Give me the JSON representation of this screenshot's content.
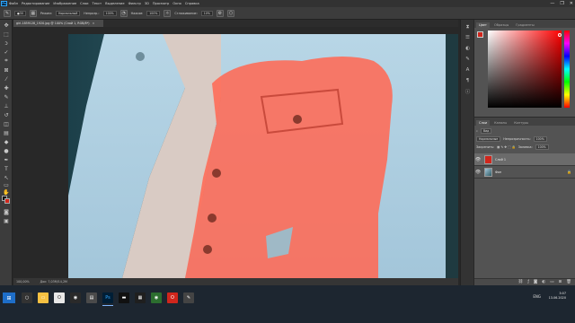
{
  "menubar": {
    "logo": "Ps",
    "items": [
      "Файл",
      "Редактирование",
      "Изображение",
      "Слои",
      "Текст",
      "Выделение",
      "Фильтр",
      "3D",
      "Просмотр",
      "Окно",
      "Справка"
    ],
    "window_controls": [
      "—",
      "❐",
      "✕"
    ]
  },
  "optionsbar": {
    "brush_size": "30",
    "mode_label": "Режим:",
    "mode_value": "Нормальный",
    "opacity_label": "Непрозр.:",
    "opacity_value": "100%",
    "flow_label": "Нажим:",
    "flow_value": "100%",
    "smoothing_label": "Сглаживание:",
    "smoothing_value": "10%"
  },
  "document": {
    "tab_title": "girl-1859128_1920.jpg @ 100% (Слой 1, RGB/8*)",
    "close_glyph": "×",
    "zoom": "100,00%",
    "doc_info": "Док: 7,03M/14,2M"
  },
  "colors": {
    "foreground": "#d0261c",
    "background": "#111111",
    "accent_highlight": "#ff6a55"
  },
  "right_panel": {
    "color_tabs": [
      "Цвет",
      "Образцы",
      "Градиенты"
    ],
    "layers_tabs": [
      "Слои",
      "Каналы",
      "Контуры"
    ],
    "filter_label": "Вид",
    "blend_mode": "Нормальные",
    "opacity_label": "Непрозрачность:",
    "opacity_value": "100%",
    "lock_label": "Закрепить:",
    "fill_label": "Заливка:",
    "fill_value": "100%",
    "layers": [
      {
        "name": "Слой 1",
        "selected": true
      },
      {
        "name": "Фон",
        "selected": false
      }
    ],
    "footer_icons": [
      "link-icon",
      "fx-icon",
      "mask-icon",
      "adjustment-icon",
      "folder-icon",
      "new-layer-icon",
      "trash-icon"
    ]
  },
  "taskbar": {
    "start": "⊞",
    "apps": [
      "file-explorer",
      "opera",
      "chrome",
      "photoshop",
      "terminal",
      "windows",
      "chrome-alt",
      "opera-alt",
      "tool"
    ],
    "clock_time": "3:07",
    "clock_date": "13.06.2020",
    "tray": "ENG"
  }
}
